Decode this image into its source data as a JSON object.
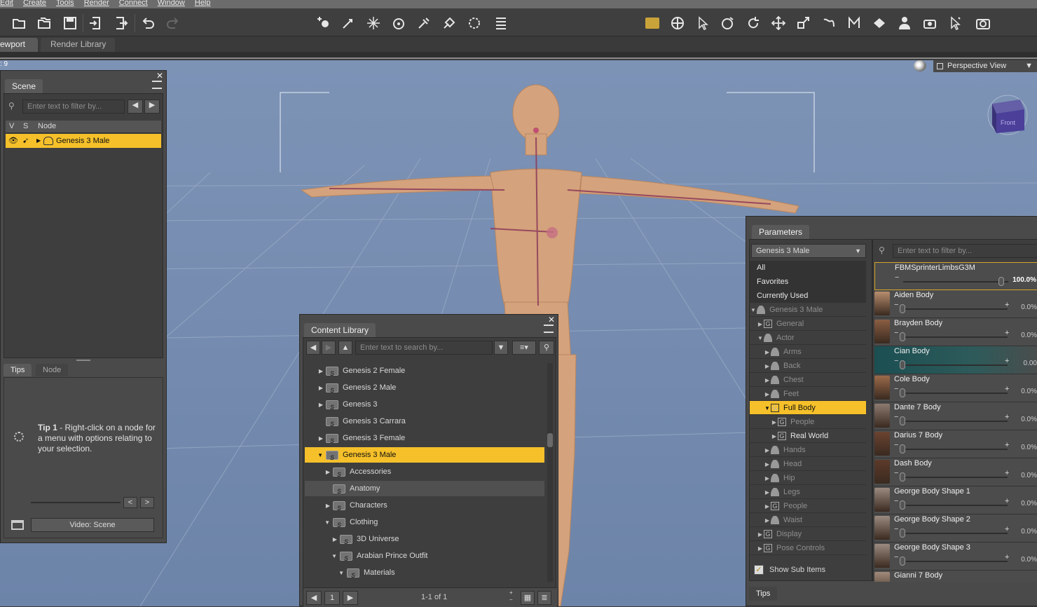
{
  "menu": [
    "Edit",
    "Create",
    "Tools",
    "Render",
    "Connect",
    "Window",
    "Help"
  ],
  "tabs": {
    "viewport": "ewport",
    "render_library": "Render Library"
  },
  "viewport": {
    "frame_label": ": 9",
    "view_mode": "Perspective View",
    "navcube_face": "Front"
  },
  "scene": {
    "tab": "Scene",
    "filter_placeholder": "Enter text to filter by...",
    "col_v": "V",
    "col_s": "S",
    "col_node": "Node",
    "node": "Genesis 3 Male",
    "bottom_tabs": [
      "Tips",
      "Node"
    ],
    "tip_title": "Tip 1",
    "tip_text": " - Right-click on a node for a menu with options relating to your selection.",
    "video_button": "Video: Scene",
    "prev": "<",
    "next": ">"
  },
  "content_library": {
    "tab": "Content Library",
    "search_placeholder": "Enter text to search by...",
    "items": [
      {
        "label": "Genesis 2 Female",
        "indent": 0,
        "arrow": "▶"
      },
      {
        "label": "Genesis 2 Male",
        "indent": 0,
        "arrow": "▶"
      },
      {
        "label": "Genesis 3",
        "indent": 0,
        "arrow": "▶"
      },
      {
        "label": "Genesis 3 Carrara",
        "indent": 0,
        "arrow": ""
      },
      {
        "label": "Genesis 3 Female",
        "indent": 0,
        "arrow": "▶"
      },
      {
        "label": "Genesis 3 Male",
        "indent": 0,
        "arrow": "▼",
        "selected": true
      },
      {
        "label": "Accessories",
        "indent": 1,
        "arrow": "▶"
      },
      {
        "label": "Anatomy",
        "indent": 1,
        "arrow": "",
        "hover": true
      },
      {
        "label": "Characters",
        "indent": 1,
        "arrow": "▶"
      },
      {
        "label": "Clothing",
        "indent": 1,
        "arrow": "▼"
      },
      {
        "label": "3D Universe",
        "indent": 2,
        "arrow": "▶"
      },
      {
        "label": "Arabian Prince Outfit",
        "indent": 2,
        "arrow": "▼"
      },
      {
        "label": "Materials",
        "indent": 3,
        "arrow": "▼"
      }
    ],
    "page": "1",
    "page_count": "1-1 of 1"
  },
  "parameters": {
    "tab": "Parameters",
    "node_select": "Genesis 3 Male",
    "filter_placeholder": "Enter text to filter by...",
    "tree": [
      {
        "label": "All",
        "indent": 0,
        "kind": "plain"
      },
      {
        "label": "Favorites",
        "indent": 0,
        "kind": "plain"
      },
      {
        "label": "Currently Used",
        "indent": 0,
        "kind": "plain"
      },
      {
        "label": "Genesis 3 Male",
        "indent": 0,
        "kind": "figure",
        "arrow": "▼",
        "dim": true
      },
      {
        "label": "General",
        "indent": 1,
        "kind": "group",
        "arrow": "▶",
        "dim": true
      },
      {
        "label": "Actor",
        "indent": 1,
        "kind": "person",
        "arrow": "▼",
        "dim": true
      },
      {
        "label": "Arms",
        "indent": 2,
        "kind": "person",
        "arrow": "▶",
        "dim": true
      },
      {
        "label": "Back",
        "indent": 2,
        "kind": "person",
        "arrow": "▶",
        "dim": true
      },
      {
        "label": "Chest",
        "indent": 2,
        "kind": "person",
        "arrow": "▶",
        "dim": true
      },
      {
        "label": "Feet",
        "indent": 2,
        "kind": "person",
        "arrow": "▶",
        "dim": true
      },
      {
        "label": "Full Body",
        "indent": 2,
        "kind": "group",
        "arrow": "▼",
        "selected": true
      },
      {
        "label": "People",
        "indent": 3,
        "kind": "group",
        "arrow": "▶",
        "dim": true
      },
      {
        "label": "Real World",
        "indent": 3,
        "kind": "group",
        "arrow": "▶"
      },
      {
        "label": "Hands",
        "indent": 2,
        "kind": "person",
        "arrow": "▶",
        "dim": true
      },
      {
        "label": "Head",
        "indent": 2,
        "kind": "person",
        "arrow": "▶",
        "dim": true
      },
      {
        "label": "Hip",
        "indent": 2,
        "kind": "person",
        "arrow": "▶",
        "dim": true
      },
      {
        "label": "Legs",
        "indent": 2,
        "kind": "person",
        "arrow": "▶",
        "dim": true
      },
      {
        "label": "People",
        "indent": 2,
        "kind": "group",
        "arrow": "▶",
        "dim": true
      },
      {
        "label": "Waist",
        "indent": 2,
        "kind": "person",
        "arrow": "▶",
        "dim": true
      },
      {
        "label": "Display",
        "indent": 1,
        "kind": "group",
        "arrow": "▶",
        "dim": true
      },
      {
        "label": "Pose Controls",
        "indent": 1,
        "kind": "group",
        "arrow": "▶",
        "dim": true
      }
    ],
    "show_sub_items": "Show Sub Items",
    "tips_tab": "Tips",
    "sliders": [
      {
        "name": "FBMSprinterLimbsG3M",
        "value": "100.0%",
        "level": 1.0,
        "color": "#4a4a4a"
      },
      {
        "name": "Aiden Body",
        "value": "0.0%",
        "level": 0,
        "color": "#b78d6d"
      },
      {
        "name": "Brayden Body",
        "value": "0.0%",
        "level": 0,
        "color": "#8a5e43"
      },
      {
        "name": "Cian Body",
        "value": "0.00",
        "level": 0,
        "color": "#1d5c5c"
      },
      {
        "name": "Cole Body",
        "value": "0.0%",
        "level": 0,
        "color": "#9b6a4a"
      },
      {
        "name": "Dante 7 Body",
        "value": "0.0%",
        "level": 0,
        "color": "#8d7a70"
      },
      {
        "name": "Darius 7 Body",
        "value": "0.0%",
        "level": 0,
        "color": "#6b4330"
      },
      {
        "name": "Dash Body",
        "value": "0.0%",
        "level": 0,
        "color": "#5d3a2a"
      },
      {
        "name": "George Body Shape 1",
        "value": "0.0%",
        "level": 0,
        "color": "#9a8a80"
      },
      {
        "name": "George Body Shape 2",
        "value": "0.0%",
        "level": 0,
        "color": "#9a8a80"
      },
      {
        "name": "George Body Shape 3",
        "value": "0.0%",
        "level": 0,
        "color": "#9a8a80"
      },
      {
        "name": "Gianni 7 Body",
        "value": "",
        "level": 0,
        "color": "#a08a7a"
      }
    ]
  },
  "colors": {
    "accent": "#f5c02a",
    "viewport": "#7b91b4",
    "panel": "#4a4a4a"
  }
}
